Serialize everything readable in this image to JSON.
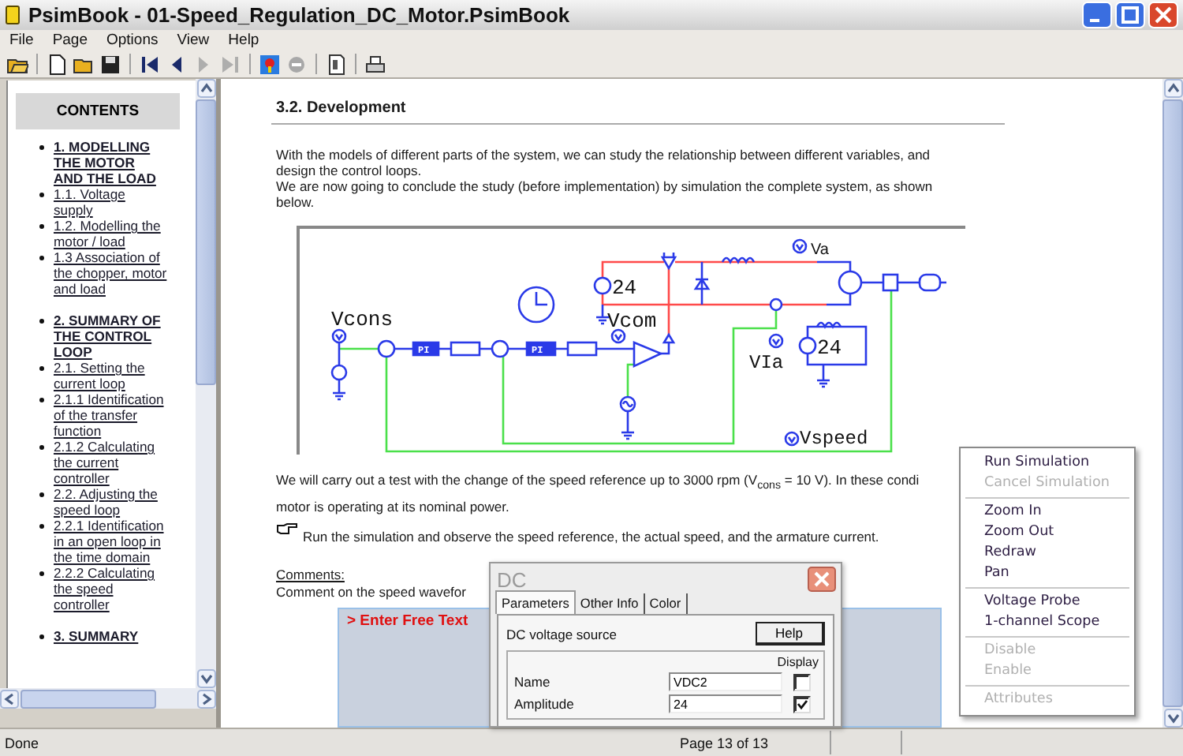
{
  "window": {
    "title": "PsimBook - 01-Speed_Regulation_DC_Motor.PsimBook"
  },
  "menu": [
    "File",
    "Page",
    "Options",
    "View",
    "Help"
  ],
  "toolbar": {
    "groups": [
      [
        {
          "kind": "open-folder",
          "disabled": false
        }
      ],
      [
        {
          "kind": "new",
          "disabled": false
        },
        {
          "kind": "open",
          "disabled": false
        },
        {
          "kind": "save",
          "disabled": false
        }
      ],
      [
        {
          "kind": "first",
          "disabled": false
        },
        {
          "kind": "previous",
          "disabled": false
        },
        {
          "kind": "next",
          "disabled": true
        },
        {
          "kind": "last",
          "disabled": true
        }
      ],
      [
        {
          "kind": "run",
          "disabled": false
        },
        {
          "kind": "stop",
          "disabled": true
        }
      ],
      [
        {
          "kind": "page",
          "disabled": false
        }
      ],
      [
        {
          "kind": "print",
          "disabled": false
        }
      ]
    ]
  },
  "contents": {
    "title": "CONTENTS",
    "items": [
      {
        "label": "1. MODELLING THE MOTOR AND THE LOAD",
        "children": [
          {
            "label": "1.1. Voltage supply"
          },
          {
            "label": "1.2. Modelling the motor / load"
          },
          {
            "label": "1.3 Association of the chopper, motor and load"
          }
        ]
      },
      {
        "label": "2. SUMMARY OF THE CONTROL LOOP",
        "children": [
          {
            "label": "2.1. Setting the current loop"
          },
          {
            "label": "2.1.1 Identification of the transfer function"
          },
          {
            "label": "2.1.2 Calculating the current controller"
          },
          {
            "label": "2.2. Adjusting the speed loop"
          },
          {
            "label": "2.2.1 Identification in an open loop in the time domain"
          },
          {
            "label": "2.2.2 Calculating the speed controller"
          }
        ]
      },
      {
        "label": "3. SUMMARY"
      }
    ]
  },
  "document": {
    "heading": "3.2. Development",
    "paragraph": "With the models of different parts of the system, we can study the relationship between different variables, and design the control loops.",
    "paragraph_2": "We are now going to conclude the study (before implementation) by simulation the complete system, as shown below.",
    "diagram": {
      "labels": [
        "Vcons",
        "Vcom",
        "24",
        "Va",
        "VIa",
        "24",
        "Vspeed",
        "PI",
        "PI"
      ]
    },
    "test_lines": [
      "We will carry out a test with the change of the speed reference up to 3000 rpm (V$_{cons}$ = 10 V). In these condi",
      "motor is operating at its nominal power."
    ],
    "instruction": "Run the simulation and observe the speed reference, the actual speed, and the armature current.",
    "comments_heading": "Comments:",
    "comments_text": "Comment on the speed wavefor",
    "answer": {
      "placeholder": "> Enter Free Text"
    }
  },
  "context_menu": [
    {
      "kind": "item",
      "label": "Run Simulation",
      "disabled": false
    },
    {
      "kind": "item",
      "label": "Cancel Simulation",
      "disabled": true
    },
    {
      "kind": "separator"
    },
    {
      "kind": "item",
      "label": "Zoom In",
      "disabled": false
    },
    {
      "kind": "item",
      "label": "Zoom Out",
      "disabled": false
    },
    {
      "kind": "item",
      "label": "Redraw",
      "disabled": false
    },
    {
      "kind": "item",
      "label": "Pan",
      "disabled": false
    },
    {
      "kind": "separator"
    },
    {
      "kind": "item",
      "label": "Voltage Probe",
      "disabled": false
    },
    {
      "kind": "item",
      "label": "1-channel Scope",
      "disabled": false
    },
    {
      "kind": "separator"
    },
    {
      "kind": "item",
      "label": "Disable",
      "disabled": true
    },
    {
      "kind": "item",
      "label": "Enable",
      "disabled": true
    },
    {
      "kind": "separator"
    },
    {
      "kind": "item",
      "label": "Attributes",
      "disabled": true
    }
  ],
  "dialog": {
    "title": "DC",
    "tabs": [
      {
        "label": "Parameters",
        "selected": true
      },
      {
        "label": "Other Info",
        "selected": false
      },
      {
        "label": "Color",
        "selected": false
      }
    ],
    "description": "DC voltage source",
    "help_button": "Help",
    "display_header": "Display",
    "fields": [
      {
        "label": "Name",
        "value": "VDC2",
        "display": false
      },
      {
        "label": "Amplitude",
        "value": "24",
        "display": true
      }
    ]
  },
  "status_bar": {
    "status": "Done",
    "page": "Page 13 of 13"
  }
}
